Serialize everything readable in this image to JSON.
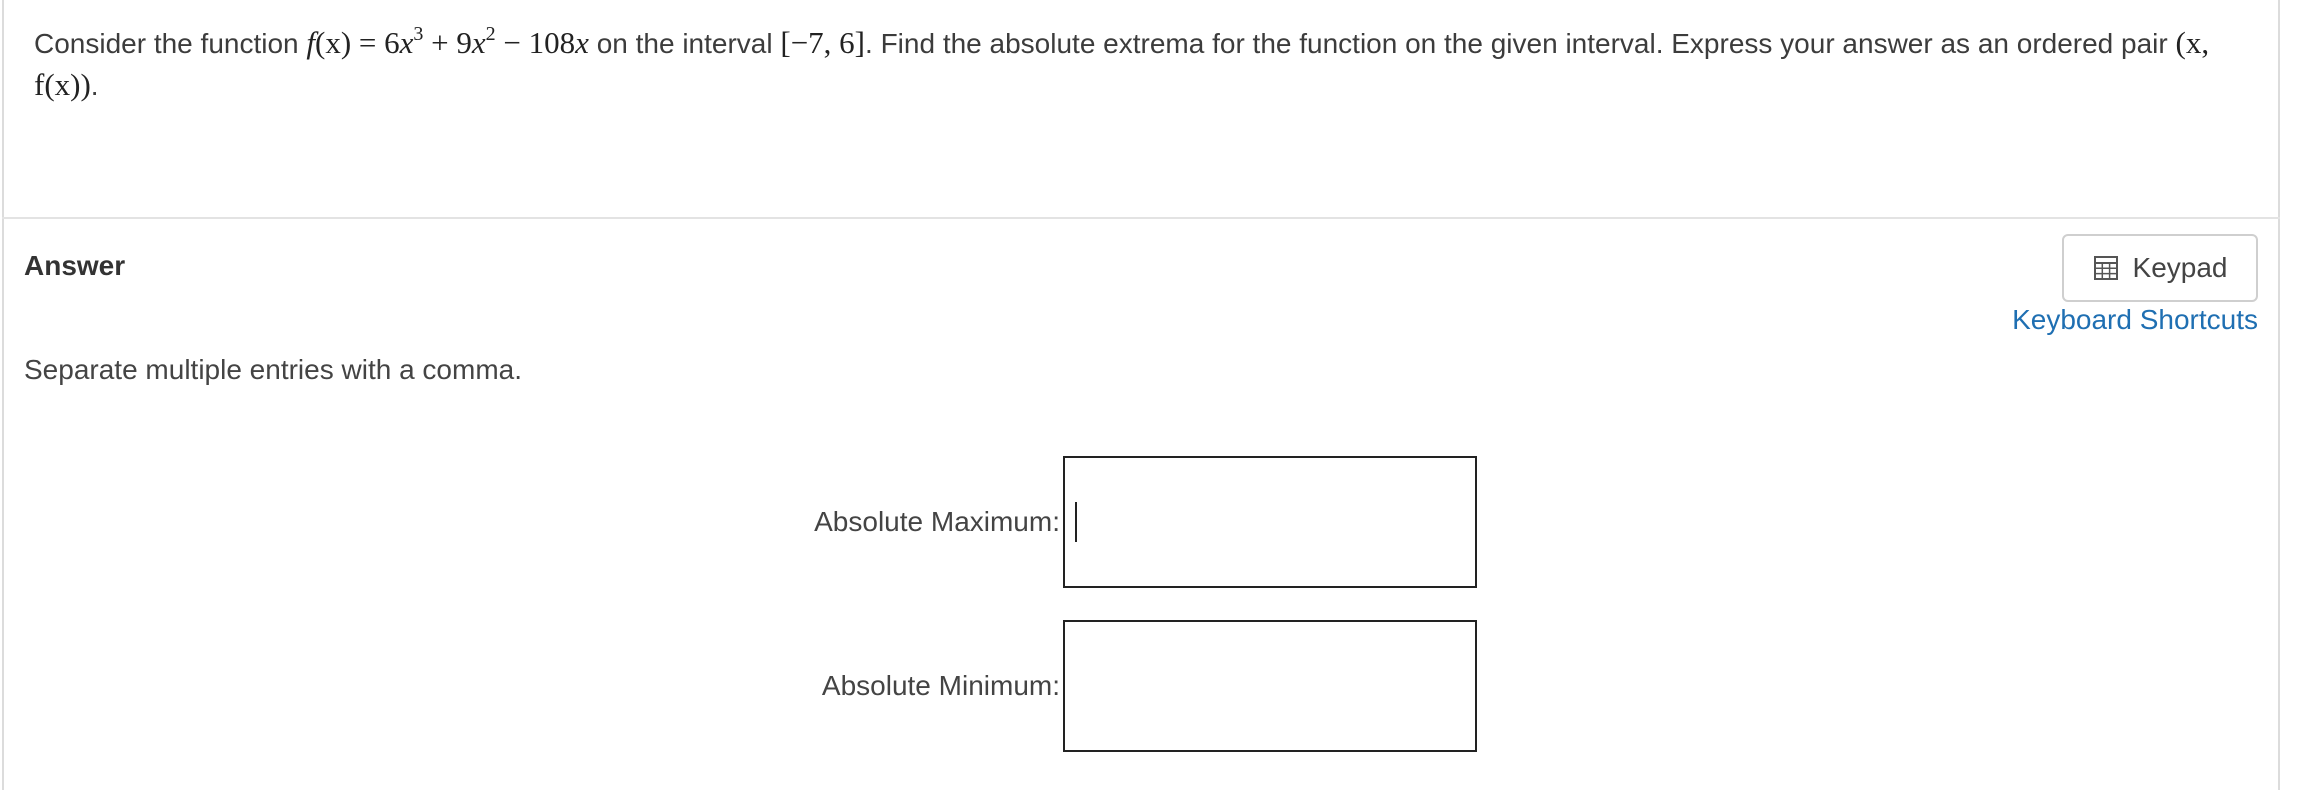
{
  "question": {
    "lead": "Consider the function",
    "fx": "f",
    "fx_arg": "(x)",
    "equals": " = ",
    "coef1": "6",
    "var1": "x",
    "exp1": "3",
    "plus": " + ",
    "coef2": "9",
    "var2": "x",
    "exp2": "2",
    "minus": " − ",
    "coef3": "108",
    "var3": "x",
    "mid": " on the interval ",
    "interval": "[−7, 6]",
    "tail": ". Find the absolute extrema for the function on the given interval. Express your answer as an ordered pair ",
    "pair": "(x, f(x))",
    "end": "."
  },
  "answer": {
    "heading": "Answer",
    "keypad_label": "Keypad",
    "keypad_icon": "calculator-icon",
    "shortcuts_label": "Keyboard Shortcuts",
    "instruction": "Separate multiple entries with a comma."
  },
  "fields": {
    "max_label": "Absolute Maximum:",
    "max_value": "",
    "min_label": "Absolute Minimum:",
    "min_value": ""
  },
  "colors": {
    "link": "#1f6fb2",
    "border": "#222222"
  }
}
